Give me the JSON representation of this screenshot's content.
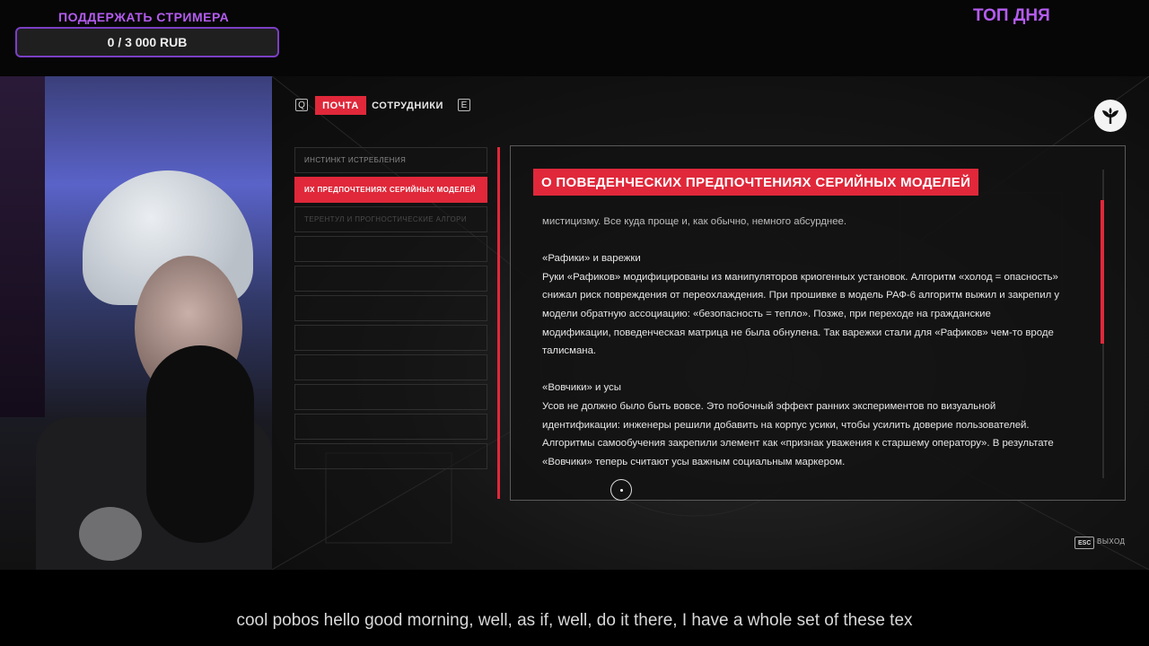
{
  "overlay": {
    "donate_title": "ПОДДЕРЖАТЬ СТРИМЕРА",
    "donate_progress": "0 / 3 000 RUB",
    "top_day": "ТОП ДНЯ"
  },
  "game": {
    "key_left": "Q",
    "key_right": "E",
    "tabs": [
      {
        "label": "ПОЧТА",
        "active": true
      },
      {
        "label": "СОТРУДНИКИ",
        "active": false
      }
    ],
    "emblem_icon": "sprout-icon",
    "list_items": [
      "Инстинкт истребления",
      "Их предпочтениях серийных моделей",
      "Терентул и прогностические алгори"
    ],
    "panel": {
      "title": "О ПОВЕДЕНЧЕСКИХ ПРЕДПОЧТЕНИЯХ СЕРИЙНЫХ МОДЕЛЕЙ",
      "lines": [
        "мистицизму. Все куда проще и, как обычно, немного абсурднее.",
        "",
        "«Рафики» и варежки",
        "Руки «Рафиков» модифицированы из манипуляторов криогенных установок. Алгоритм «холод = опасность»",
        "снижал риск повреждения от переохлаждения. При прошивке в модель РАФ-6 алгоритм выжил и закрепил у",
        "модели обратную ассоциацию: «безопасность = тепло». Позже, при переходе на гражданские",
        "модификации, поведенческая матрица не была обнулена. Так варежки стали для «Рафиков» чем-то вроде",
        "талисмана.",
        "",
        "«Вовчики» и усы",
        "Усов не должно было быть вовсе. Это побочный эффект ранних экспериментов по визуальной",
        "идентификации: инженеры решили добавить на корпус усики, чтобы усилить доверие пользователей.",
        "Алгоритмы самообучения закрепили элемент как «признак уважения к старшему оператору». В результате",
        "«Вовчики» теперь считают усы важным социальным маркером."
      ]
    },
    "esc_key": "ESC",
    "esc_label": "ВЫХОД"
  },
  "subtitle": "cool pobos hello good morning, well, as if, well, do it there, I have a whole set of these tex"
}
